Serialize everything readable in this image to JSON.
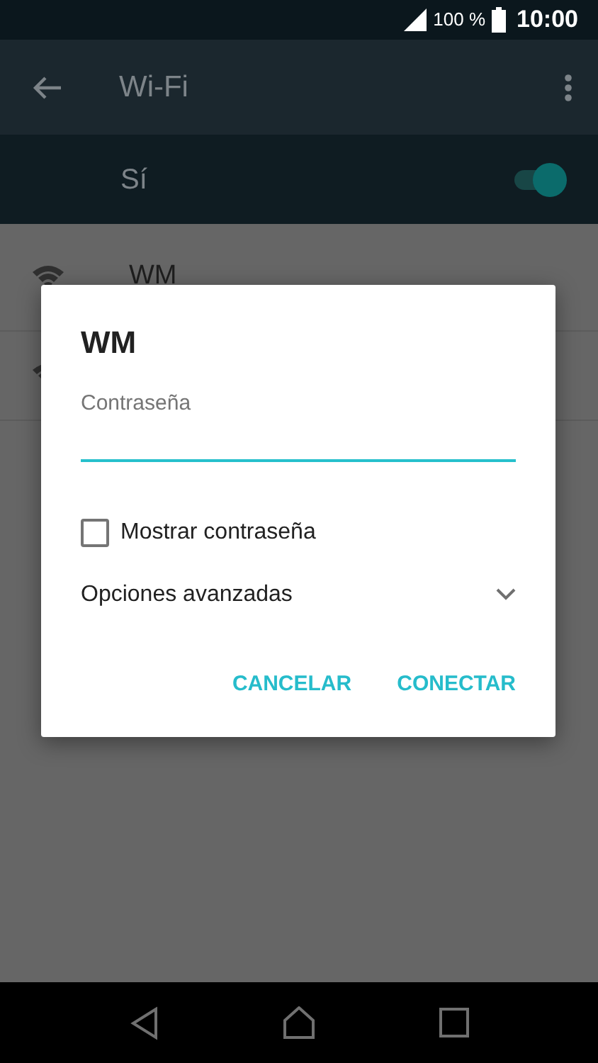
{
  "status_bar": {
    "battery": "100 %",
    "time": "10:00"
  },
  "app_bar": {
    "title": "Wi-Fi"
  },
  "wifi_switch": {
    "label": "Sí",
    "on": true
  },
  "networks": [
    {
      "kind": "named",
      "name": "WM"
    },
    {
      "kind": "covered"
    }
  ],
  "dialog": {
    "title": "WM",
    "field_label": "Contraseña",
    "focused": true,
    "show_password": {
      "label": "Mostrar contraseña",
      "checked": false
    },
    "advanced": {
      "label": "Opciones avanzadas",
      "expanded": false
    },
    "buttons": [
      "CANCELAR",
      "CONECTAR"
    ]
  }
}
